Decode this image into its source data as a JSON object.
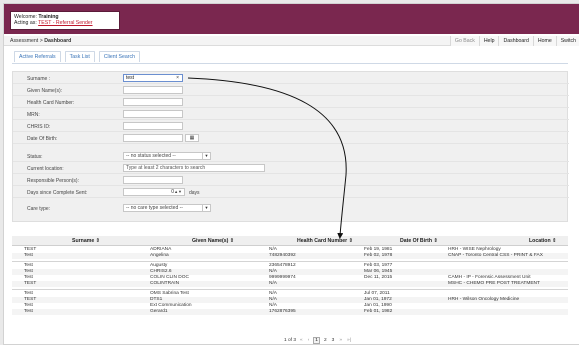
{
  "header": {
    "welcome_prefix": "Welcome:",
    "welcome_user": "Training",
    "acting_prefix": "Acting as:",
    "acting_role": "TEST - Referral Sender"
  },
  "nav": {
    "crumb_root": "Assessment",
    "crumb_sep": ">",
    "crumb_current": "Dashboard",
    "buttons": [
      "Go Back",
      "Help",
      "Dashboard",
      "Home",
      "Switch"
    ]
  },
  "tabs": [
    "Active Referrals",
    "Task List",
    "Client Search"
  ],
  "search_form": {
    "surname_label": "Surname :",
    "surname_value": "test",
    "given_label": "Given Name(s):",
    "hcn_label": "Health Card Number:",
    "mrn_label": "MRN:",
    "chris_label": "CHRIS ID:",
    "dob_label": "Date Of Birth:",
    "status_label": "Status:",
    "status_value": "-- no status selected --",
    "location_label": "Current location:",
    "location_placeholder": "Type at least 2 characters to search",
    "responsible_label": "Responsible Person(s):",
    "days_label": "Days since Complete Sent:",
    "days_value": "0",
    "days_unit": "days",
    "caretype_label": "Care type:",
    "caretype_value": "-- no care type selected --"
  },
  "results": {
    "columns": [
      "Surname",
      "Given Name(s)",
      "Health Card Number",
      "Date Of Birth",
      "Location"
    ],
    "rows": [
      [
        "TEST",
        "ADRIANA",
        "N/A",
        "Feb 19, 1981",
        "HRH - WISE Nephrology"
      ],
      [
        "Test",
        "Angelina",
        "7482940392",
        "Feb 02, 1978",
        "CNAP - Toronto Central CSS - PRINT & FAX"
      ],
      [
        "Test",
        "Augusty",
        "2365478912",
        "Feb 03, 1977",
        ""
      ],
      [
        "Test",
        "CHRIS2.6",
        "N/A",
        "Mar 06, 1945",
        ""
      ],
      [
        "Test",
        "COLIN CLIN DOC",
        "9999999974",
        "Dec 11, 2015",
        "CAMH - IP - Forensic Assessment Unit"
      ],
      [
        "TEST",
        "COLINTRAIN",
        "N/A",
        "",
        "MSHC - CHEMO PRE POST TREATMENT"
      ],
      [
        "Test",
        "OMS Sabrina Test",
        "N/A",
        "Jul 07, 2011",
        ""
      ],
      [
        "TEST",
        "DTS1",
        "N/A",
        "Jan 01, 1972",
        "HRH - Wilson Oncology Medicine"
      ],
      [
        "Test",
        "Ext Communication",
        "N/A",
        "Jan 01, 1990",
        ""
      ],
      [
        "Test",
        "Gerard1",
        "1762876395",
        "Feb 01, 1982",
        ""
      ]
    ]
  },
  "pager": {
    "summary": "1 of 3",
    "first": "«",
    "prev": "‹",
    "pages": [
      "1",
      "2",
      "3"
    ],
    "next": "»",
    "last": "»|"
  },
  "colors": {
    "header_bg": "#7a274f",
    "link": "#3873b8",
    "acting_link": "#c0182c"
  }
}
